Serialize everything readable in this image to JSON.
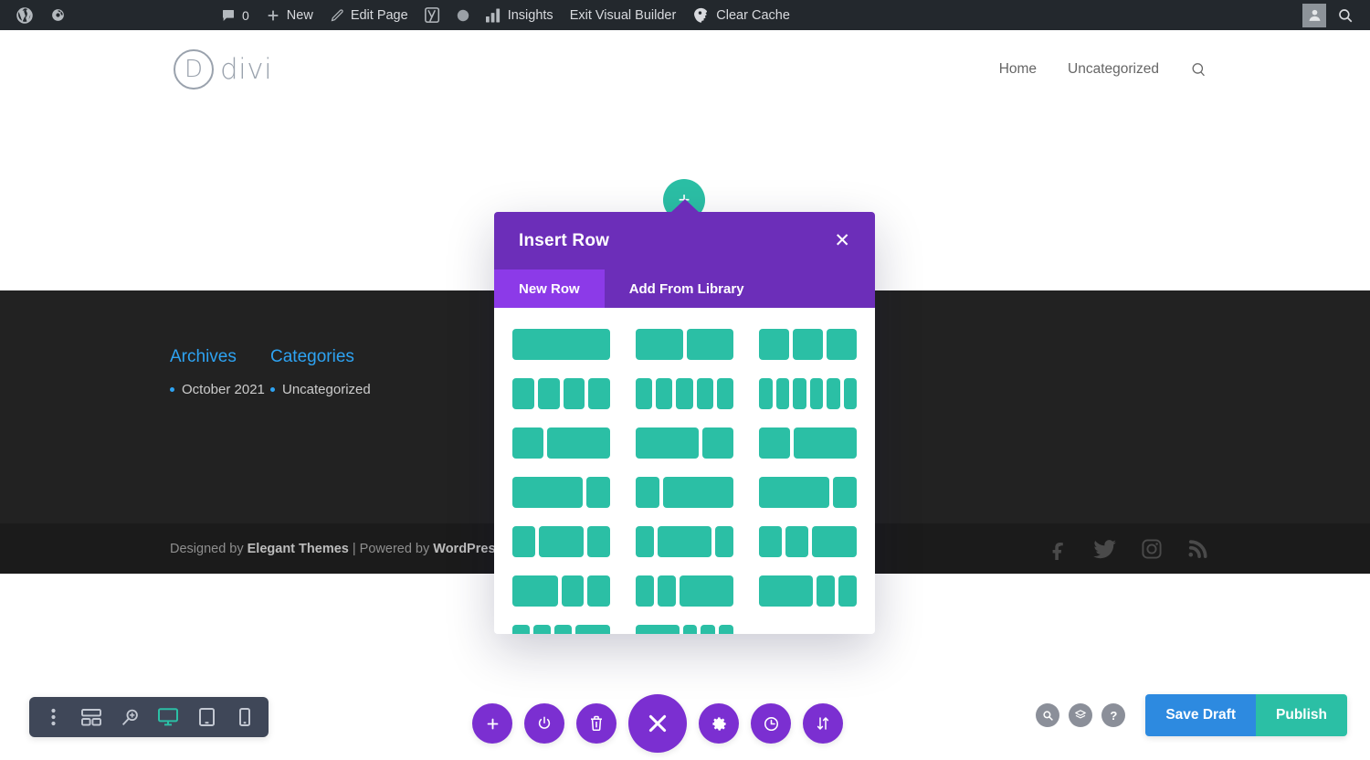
{
  "adminbar": {
    "left_items": [
      {
        "name": "wordpress-logo",
        "label": "",
        "icon": "wordpress-icon"
      },
      {
        "name": "site-dashboard",
        "label": "",
        "icon": "dashboard-icon"
      }
    ],
    "center_items": [
      {
        "name": "comments",
        "label": "0",
        "icon": "comment-icon"
      },
      {
        "name": "new-content",
        "label": "New",
        "icon": "plus-icon"
      },
      {
        "name": "edit-page",
        "label": "Edit Page",
        "icon": "pencil-icon"
      },
      {
        "name": "yoast-seo",
        "label": "",
        "icon": "yoast-icon"
      },
      {
        "name": "seo-status",
        "label": "",
        "icon": "circle-icon"
      },
      {
        "name": "insights",
        "label": "Insights",
        "icon": "bar-chart-icon"
      },
      {
        "name": "exit-visual-builder",
        "label": "Exit Visual Builder",
        "icon": ""
      },
      {
        "name": "clear-cache",
        "label": "Clear Cache",
        "icon": "rocket-icon"
      }
    ],
    "right_items": [
      {
        "name": "user-account",
        "label": "",
        "icon": "user-avatar-icon"
      },
      {
        "name": "search",
        "label": "",
        "icon": "search-icon"
      }
    ]
  },
  "siteheader": {
    "logo_letter": "D",
    "logo_text": "divi",
    "nav": [
      {
        "label": "Home"
      },
      {
        "label": "Uncategorized"
      }
    ],
    "search_icon": "search-icon"
  },
  "footer": {
    "widgets": [
      {
        "title": "Archives",
        "items": [
          "October 2021"
        ]
      },
      {
        "title": "Categories",
        "items": [
          "Uncategorized"
        ]
      }
    ],
    "credit_prefix": "Designed by ",
    "credit_brand1": "Elegant Themes",
    "credit_middle": " | Powered by ",
    "credit_brand2": "WordPress",
    "social": [
      "facebook-icon",
      "twitter-icon",
      "instagram-icon",
      "rss-icon"
    ]
  },
  "add_row_button": {
    "label": "+",
    "color": "#2bbfa5"
  },
  "modal": {
    "title": "Insert Row",
    "close_label": "✕",
    "tabs": [
      {
        "label": "New Row",
        "active": true
      },
      {
        "label": "Add From Library",
        "active": false
      }
    ],
    "accent_header": "#6c2eb9",
    "accent_tab_active": "#8c3ae8",
    "block_color": "#2bbfa5",
    "layouts": [
      {
        "name": "1-column",
        "cols": [
          1
        ]
      },
      {
        "name": "2-columns-equal",
        "cols": [
          1,
          1
        ]
      },
      {
        "name": "3-columns-equal",
        "cols": [
          1,
          1,
          1
        ]
      },
      {
        "name": "4-columns-equal",
        "cols": [
          1,
          1,
          1,
          1
        ]
      },
      {
        "name": "5-columns-equal",
        "cols": [
          1,
          1,
          1,
          1,
          1
        ]
      },
      {
        "name": "6-columns-equal",
        "cols": [
          1,
          1,
          1,
          1,
          1,
          1
        ]
      },
      {
        "name": "one-third-two-third",
        "cols": [
          1,
          2
        ]
      },
      {
        "name": "two-third-one-third",
        "cols": [
          2,
          1
        ]
      },
      {
        "name": "one-fourth-three-fourth",
        "cols": [
          1,
          2
        ]
      },
      {
        "name": "three-fourth-one-fourth",
        "cols": [
          3,
          1
        ]
      },
      {
        "name": "one-fourth-three-fourth-b",
        "cols": [
          1,
          3
        ]
      },
      {
        "name": "three-fourth-one-fourth-b",
        "cols": [
          3,
          1
        ]
      },
      {
        "name": "one-fourth-half-one-fourth",
        "cols": [
          1,
          2,
          1
        ]
      },
      {
        "name": "one-fifth-three-fifth-one-fifth",
        "cols": [
          1,
          3,
          1
        ]
      },
      {
        "name": "one-fourth-one-fourth-half",
        "cols": [
          1,
          1,
          2
        ]
      },
      {
        "name": "half-one-fourth-one-fourth",
        "cols": [
          2,
          1,
          1
        ]
      },
      {
        "name": "one-fifth-one-fifth-three-fifth",
        "cols": [
          1,
          1,
          3
        ]
      },
      {
        "name": "three-fifth-one-fifth-one-fifth",
        "cols": [
          3,
          1,
          1
        ]
      },
      {
        "name": "quarter-quarter-quarter-half",
        "cols": [
          1,
          1,
          1,
          2
        ]
      },
      {
        "name": "half-quarter-quarter-quarter",
        "cols": [
          3,
          1,
          1,
          1
        ]
      }
    ]
  },
  "toolbar_left": {
    "items": [
      {
        "name": "more-options",
        "icon": "vertical-dots-icon",
        "active": false
      },
      {
        "name": "wireframe-view",
        "icon": "wireframe-icon",
        "active": false
      },
      {
        "name": "zoom-view",
        "icon": "zoom-out-icon",
        "active": false
      },
      {
        "name": "desktop-view",
        "icon": "desktop-icon",
        "active": true
      },
      {
        "name": "tablet-view",
        "icon": "tablet-icon",
        "active": false
      },
      {
        "name": "phone-view",
        "icon": "phone-icon",
        "active": false
      }
    ]
  },
  "toolbar_center": {
    "items": [
      {
        "name": "add-section",
        "icon": "plus-icon",
        "big": false
      },
      {
        "name": "save-to-library",
        "icon": "power-icon",
        "big": false
      },
      {
        "name": "clear-layout",
        "icon": "trash-icon",
        "big": false
      },
      {
        "name": "close-settings-menu",
        "icon": "close-x-icon",
        "big": true
      },
      {
        "name": "page-settings",
        "icon": "gear-icon",
        "big": false
      },
      {
        "name": "editing-history",
        "icon": "clock-icon",
        "big": false
      },
      {
        "name": "portability",
        "icon": "sort-arrows-icon",
        "big": false
      }
    ]
  },
  "toolbar_right": {
    "circles": [
      {
        "name": "search-modules",
        "icon": "search-icon",
        "label": ""
      },
      {
        "name": "layers-view",
        "icon": "layers-icon",
        "label": ""
      },
      {
        "name": "help",
        "icon": "question-icon",
        "label": "?"
      }
    ],
    "save_draft_label": "Save Draft",
    "publish_label": "Publish",
    "save_draft_color": "#2d8ae0",
    "publish_color": "#2bbfa5"
  }
}
